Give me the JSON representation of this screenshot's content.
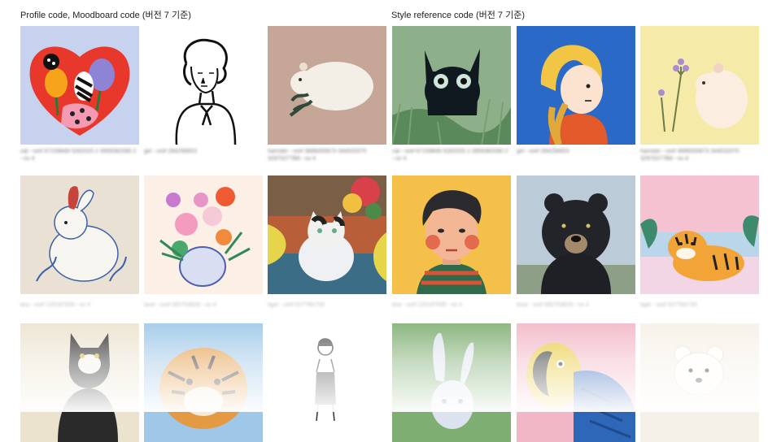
{
  "sections": {
    "profile_title": "Profile code, Moodboard code (버전 7 기준)",
    "style_title": "Style reference code (버전 7 기준)"
  },
  "captions": {
    "row1": [
      "cat --sref 67159849 5282025 2 3959382090 2 --sv 4",
      "girl --sref 284256653",
      "hamster --sref 3686000673 344532070 32970277B8 --sv 4",
      "cat --sref 67159849 5282025 2 3959382090 2 --sv 4",
      "girl --sref 284256653",
      "hamster --sref 3686000673 344532070 32970277B8 --sv 4"
    ],
    "row2": [
      "boy --sref 120187935 --sv 4",
      "bear --sref 592704626 --sv 4",
      "tiger --sref 52776A733",
      "boy --sref 120187935 --sv 4",
      "bear --sref 592704626 --sv 4",
      "tiger --sref 52776A733"
    ]
  },
  "icons": [
    "heart-tulips",
    "girl-line",
    "hamster",
    "black-cat",
    "blonde-girl",
    "hamster-flowers",
    "rabbit",
    "flower-vase",
    "calico-cat",
    "boy-portrait",
    "black-bear",
    "tiger-pink",
    "tuxedo-cat",
    "tiger-face",
    "girl-figure",
    "rabbit-green",
    "parrot",
    "white-bear"
  ],
  "colors": {
    "caption": "#777777",
    "title": "#222222"
  }
}
